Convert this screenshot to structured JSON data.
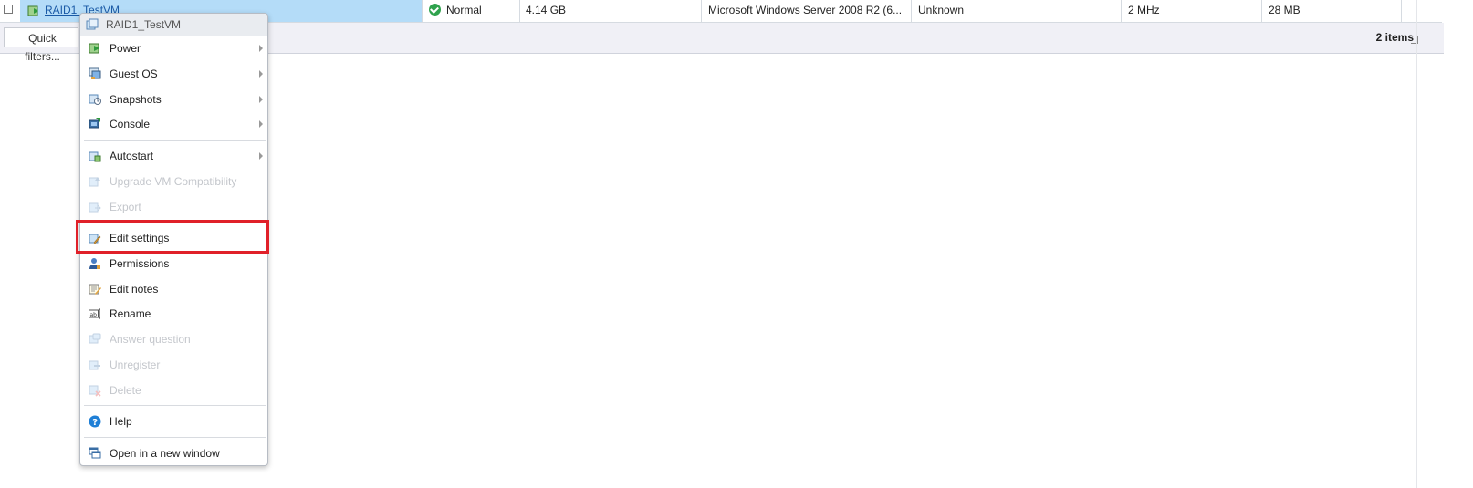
{
  "table": {
    "row": {
      "vm_name": "RAID1_TestVM",
      "status": "Normal",
      "provisioned_space": "4.14 GB",
      "guest_os": "Microsoft Windows Server 2008 R2 (6...",
      "host_name": "Unknown",
      "cpu": "2 MHz",
      "memory": "28 MB"
    }
  },
  "footer": {
    "quick_filters_label": "Quick filters...",
    "item_count": "2 items"
  },
  "context_menu": {
    "header": "RAID1_TestVM",
    "items": [
      {
        "label": "Power",
        "icon": "power-icon",
        "submenu": true,
        "enabled": true
      },
      {
        "label": "Guest OS",
        "icon": "guest-os-icon",
        "submenu": true,
        "enabled": true
      },
      {
        "label": "Snapshots",
        "icon": "snapshots-icon",
        "submenu": true,
        "enabled": true
      },
      {
        "label": "Console",
        "icon": "console-icon",
        "submenu": true,
        "enabled": true
      },
      {
        "label": "Autostart",
        "icon": "autostart-icon",
        "submenu": true,
        "enabled": true
      },
      {
        "label": "Upgrade VM Compatibility",
        "icon": "upgrade-icon",
        "submenu": false,
        "enabled": false
      },
      {
        "label": "Export",
        "icon": "export-icon",
        "submenu": false,
        "enabled": false
      },
      {
        "label": "Edit settings",
        "icon": "edit-settings-icon",
        "submenu": false,
        "enabled": true,
        "highlighted": true
      },
      {
        "label": "Permissions",
        "icon": "permissions-icon",
        "submenu": false,
        "enabled": true
      },
      {
        "label": "Edit notes",
        "icon": "edit-notes-icon",
        "submenu": false,
        "enabled": true
      },
      {
        "label": "Rename",
        "icon": "rename-icon",
        "submenu": false,
        "enabled": true
      },
      {
        "label": "Answer question",
        "icon": "answer-question-icon",
        "submenu": false,
        "enabled": false
      },
      {
        "label": "Unregister",
        "icon": "unregister-icon",
        "submenu": false,
        "enabled": false
      },
      {
        "label": "Delete",
        "icon": "delete-icon",
        "submenu": false,
        "enabled": false
      },
      {
        "label": "Help",
        "icon": "help-icon",
        "submenu": false,
        "enabled": true
      },
      {
        "label": "Open in a new window",
        "icon": "open-new-window-icon",
        "submenu": false,
        "enabled": true
      }
    ]
  },
  "colors": {
    "selection": "#b4dcf8",
    "highlight_border": "#e02029",
    "status_ok": "#2fa24d",
    "link": "#1a5aa6"
  }
}
